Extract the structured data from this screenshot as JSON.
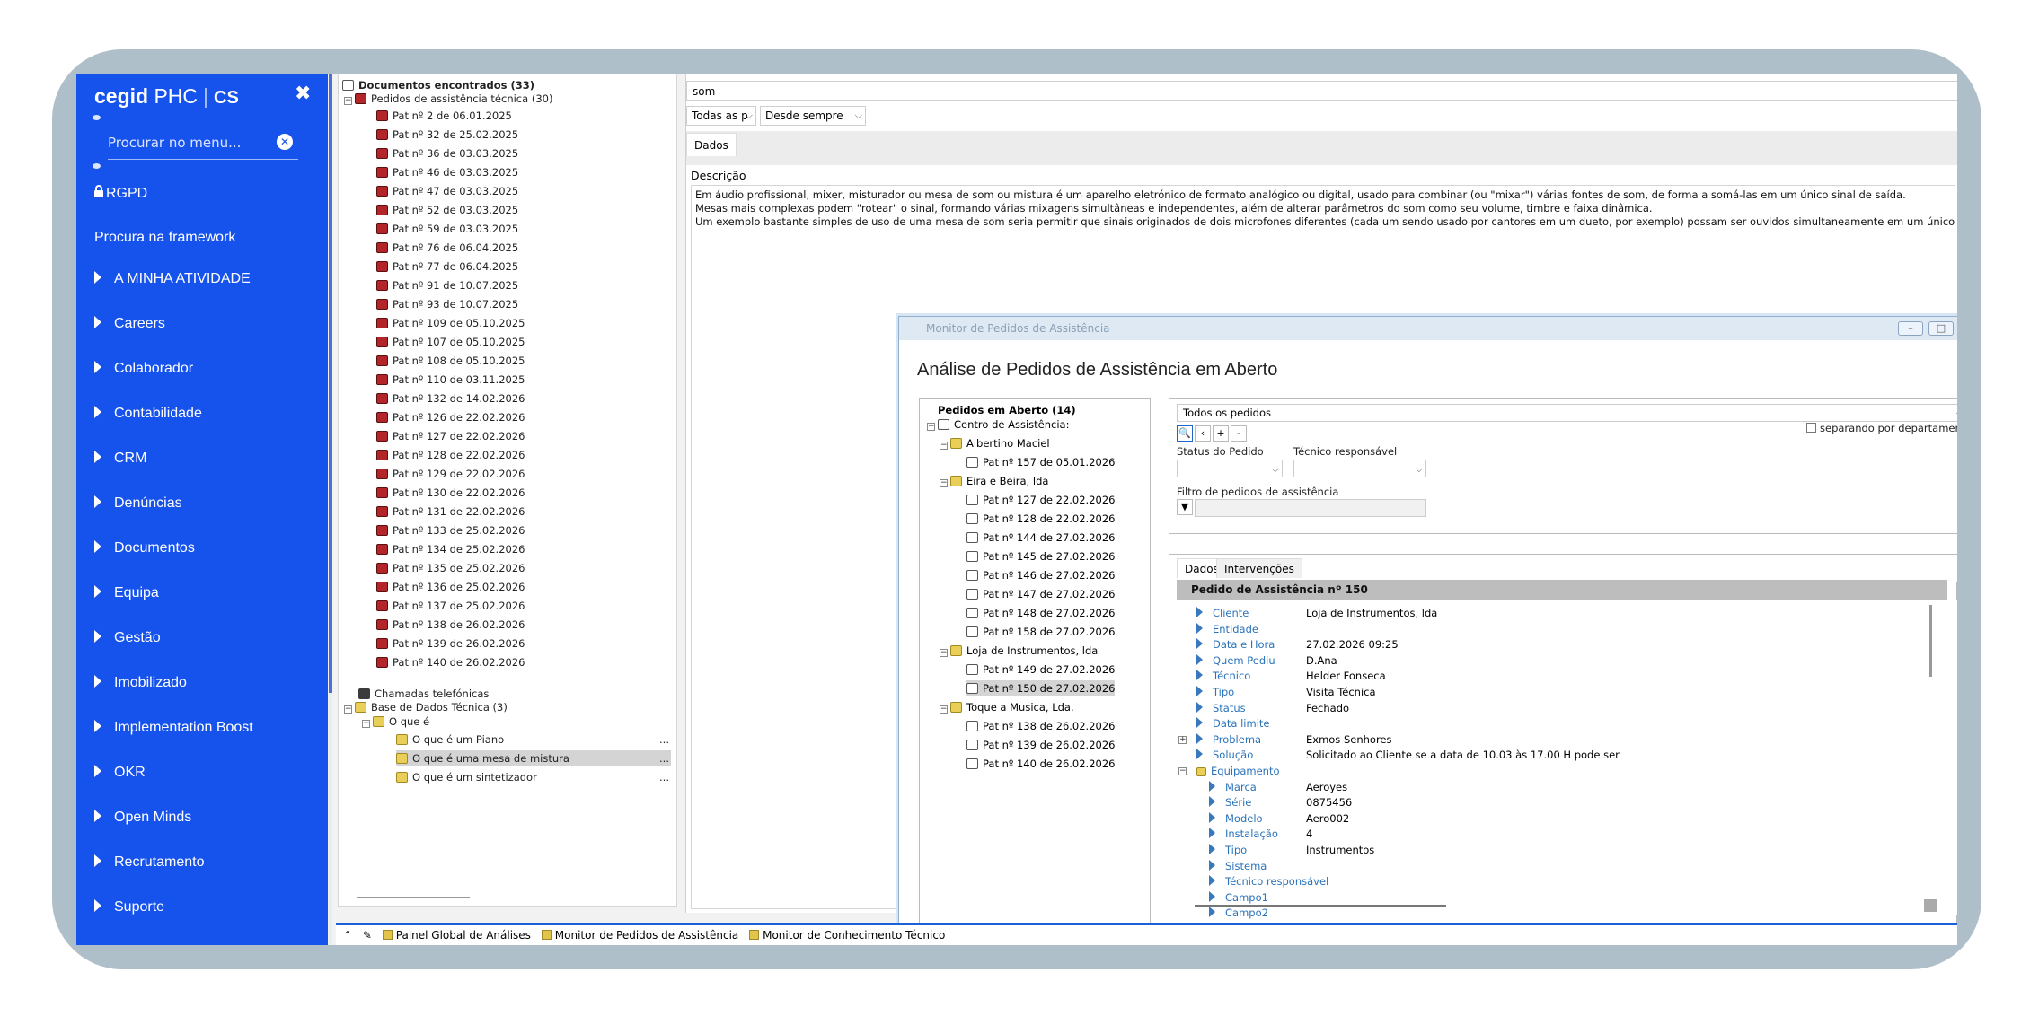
{
  "sidebar": {
    "brand": "cegid",
    "brand_product": "PHC",
    "brand_suffix": "CS",
    "search_placeholder": "Procurar no menu...",
    "rgpd": "RGPD",
    "framework": "Procura na framework",
    "items": [
      "A MINHA ATIVIDADE",
      "Careers",
      "Colaborador",
      "Contabilidade",
      "CRM",
      "Denúncias",
      "Documentos",
      "Equipa",
      "Gestão",
      "Imobilizado",
      "Implementation Boost",
      "OKR",
      "Open Minds",
      "Recrutamento",
      "Suporte"
    ]
  },
  "doc_tree": {
    "root": "Documentos encontrados (33)",
    "group1": "Pedidos de assistência técnica (30)",
    "pats": [
      "Pat nº 2 de 06.01.2025",
      "Pat nº 32 de 25.02.2025",
      "Pat nº 36 de 03.03.2025",
      "Pat nº 46 de 03.03.2025",
      "Pat nº 47 de 03.03.2025",
      "Pat nº 52 de 03.03.2025",
      "Pat nº 59 de 03.03.2025",
      "Pat nº 76 de 06.04.2025",
      "Pat nº 77 de 06.04.2025",
      "Pat nº 91 de 10.07.2025",
      "Pat nº 93 de 10.07.2025",
      "Pat nº 109 de 05.10.2025",
      "Pat nº 107 de 05.10.2025",
      "Pat nº 108 de 05.10.2025",
      "Pat nº 110 de 03.11.2025",
      "Pat nº 132 de 14.02.2026",
      "Pat nº 126 de 22.02.2026",
      "Pat nº 127 de 22.02.2026",
      "Pat nº 128 de 22.02.2026",
      "Pat nº 129 de 22.02.2026",
      "Pat nº 130 de 22.02.2026",
      "Pat nº 131 de 22.02.2026",
      "Pat nº 133 de 25.02.2026",
      "Pat nº 134 de 25.02.2026",
      "Pat nº 135 de 25.02.2026",
      "Pat nº 136 de 25.02.2026",
      "Pat nº 137 de 25.02.2026",
      "Pat nº 138 de 26.02.2026",
      "Pat nº 139 de 26.02.2026",
      "Pat nº 140 de 26.02.2026"
    ],
    "calls": "Chamadas telefónicas",
    "kb": "Base de Dados Técnica (3)",
    "kb_folder": "O que é",
    "kb_items": [
      "O que é um Piano",
      "O que é uma mesa de mistura",
      "O que é um sintetizador"
    ],
    "ellipsis": "..."
  },
  "content": {
    "search_value": "som",
    "filter1": "Todas as p",
    "filter2": "Desde sempre",
    "tab": "Dados",
    "desc_label": "Descrição",
    "desc_lines": [
      "Em áudio profissional, mixer, misturador ou mesa de som ou mistura é um aparelho eletrónico de formato analógico ou digital, usado para combinar (ou \"mixar\") várias fontes de som, de forma a somá-las em um único sinal de saída.",
      "Mesas mais complexas podem \"rotear\" o sinal, formando várias mixagens simultâneas e independentes, além de alterar parâmetros do som como seu volume, timbre e faixa dinâmica.",
      "Um exemplo bastante simples de uso de uma mesa de som seria permitir que sinais originados de dois microfones diferentes (cada um sendo usado por cantores em um dueto, por exemplo) possam ser ouvidos simultaneamente em um único alto-falante."
    ]
  },
  "monitor": {
    "window_title": "Monitor de Pedidos de Assistência",
    "heading": "Análise de Pedidos de Assistência em Aberto",
    "tree_root": "Pedidos em Aberto (14)",
    "center": "Centro de Assistência:",
    "groups": [
      {
        "name": "Albertino Maciel",
        "pats": [
          "Pat nº 157 de 05.01.2026"
        ]
      },
      {
        "name": "Eira e Beira, lda",
        "pats": [
          "Pat nº 127 de 22.02.2026",
          "Pat nº 128 de 22.02.2026",
          "Pat nº 144 de 27.02.2026",
          "Pat nº 145 de 27.02.2026",
          "Pat nº 146 de 27.02.2026",
          "Pat nº 147 de 27.02.2026",
          "Pat nº 148 de 27.02.2026",
          "Pat nº 158 de 27.02.2026"
        ]
      },
      {
        "name": "Loja de Instrumentos, lda",
        "pats": [
          "Pat nº 149 de 27.02.2026",
          "Pat nº 150 de 27.02.2026"
        ]
      },
      {
        "name": "Toque a Musica, Lda.",
        "pats": [
          "Pat nº 138 de 26.02.2026",
          "Pat nº 139 de 26.02.2026",
          "Pat nº 140 de 26.02.2026"
        ]
      }
    ],
    "filter_all": "Todos os pedidos",
    "sep_dept": "separando por departamento.",
    "status_label": "Status do Pedido",
    "tech_label": "Técnico responsável",
    "filter_label": "Filtro de pedidos de assistência",
    "tab_dados": "Dados",
    "tab_interv": "Intervenções",
    "detail_title": "Pedido de Assistência nº 150",
    "fields": [
      {
        "label": "Cliente",
        "value": "Loja de Instrumentos, lda"
      },
      {
        "label": "Entidade",
        "value": ""
      },
      {
        "label": "Data e Hora",
        "value": "27.02.2026 09:25"
      },
      {
        "label": "Quem Pediu",
        "value": "D.Ana"
      },
      {
        "label": "Técnico",
        "value": "Helder Fonseca"
      },
      {
        "label": "Tipo",
        "value": "Visita Técnica"
      },
      {
        "label": "Status",
        "value": "Fechado"
      },
      {
        "label": "Data limite",
        "value": ""
      },
      {
        "label": "Problema",
        "value": "Exmos Senhores"
      },
      {
        "label": "Solução",
        "value": "Solicitado ao Cliente se a data de 10.03 às 17.00 H pode ser"
      },
      {
        "label": "Equipamento",
        "value": ""
      }
    ],
    "equip": [
      {
        "label": "Marca",
        "value": "Aeroyes"
      },
      {
        "label": "Série",
        "value": "0875456"
      },
      {
        "label": "Modelo",
        "value": "Aero002"
      },
      {
        "label": "Instalação",
        "value": "4"
      },
      {
        "label": "Tipo",
        "value": "Instrumentos"
      },
      {
        "label": "Sistema",
        "value": ""
      },
      {
        "label": "Técnico responsável",
        "value": ""
      },
      {
        "label": "Campo1",
        "value": ""
      },
      {
        "label": "Campo2",
        "value": ""
      }
    ]
  },
  "taskbar": [
    "Painel Global de Análises",
    "Monitor de Pedidos de Assistência",
    "Monitor de Conhecimento Técnico"
  ]
}
